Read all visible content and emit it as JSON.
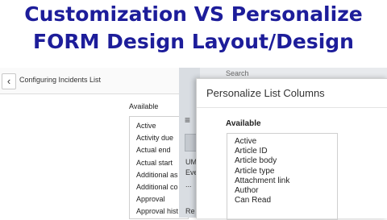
{
  "banner": {
    "line1": "Customization VS Personalize",
    "line2": "FORM Design Layout/Design"
  },
  "left_panel": {
    "title": "Configuring Incidents List",
    "available_label": "Available",
    "items": [
      "Active",
      "Activity due",
      "Actual end",
      "Actual start",
      "Additional as",
      "Additional co",
      "Approval",
      "Approval hist"
    ]
  },
  "middle": {
    "texts": [
      "UM",
      "Eve",
      "...",
      "Re"
    ]
  },
  "search": {
    "placeholder": "Search"
  },
  "overlay": {
    "title": "Personalize List Columns",
    "available_label": "Available",
    "items": [
      "Active",
      "Article ID",
      "Article body",
      "Article type",
      "Attachment link",
      "Author",
      "Can Read"
    ]
  }
}
